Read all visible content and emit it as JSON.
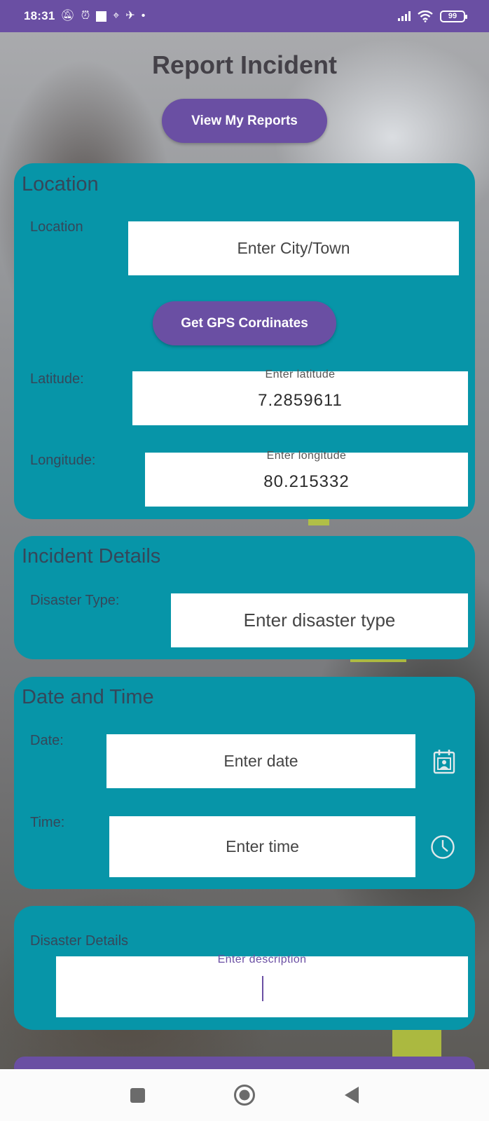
{
  "status_bar": {
    "time": "18:31",
    "battery": "99",
    "left_icons": [
      "mute-icon",
      "alarm-icon",
      "square-icon",
      "location-pin-icon",
      "gamepad-icon",
      "dot-icon"
    ],
    "right_icons": [
      "signal-icon",
      "wifi-icon",
      "battery-icon"
    ]
  },
  "header": {
    "title": "Report Incident",
    "view_reports_label": "View My Reports"
  },
  "location_card": {
    "title": "Location",
    "location_label": "Location",
    "location_placeholder": "Enter City/Town",
    "gps_button_label": "Get GPS Cordinates",
    "latitude_label": "Latitude:",
    "latitude_hint": "Enter latitude",
    "latitude_value": "7.2859611",
    "longitude_label": "Longitude:",
    "longitude_hint": "Enter longitude",
    "longitude_value": "80.215332"
  },
  "incident_card": {
    "title": "Incident Details",
    "disaster_type_label": "Disaster Type:",
    "disaster_type_placeholder": "Enter disaster type"
  },
  "datetime_card": {
    "title": "Date and Time",
    "date_label": "Date:",
    "date_placeholder": "Enter date",
    "time_label": "Time:",
    "time_placeholder": "Enter time",
    "date_icon": "calendar-icon",
    "time_icon": "clock-icon"
  },
  "details_card": {
    "details_label": "Disaster Details",
    "description_hint": "Enter description"
  },
  "nav_bar": {
    "icons": [
      "recents-icon",
      "home-icon",
      "back-icon"
    ]
  },
  "colors": {
    "status_bar": "#6a4fa3",
    "card": "#0795a8",
    "button": "#6a4fa3",
    "label_text": "#35475a"
  }
}
